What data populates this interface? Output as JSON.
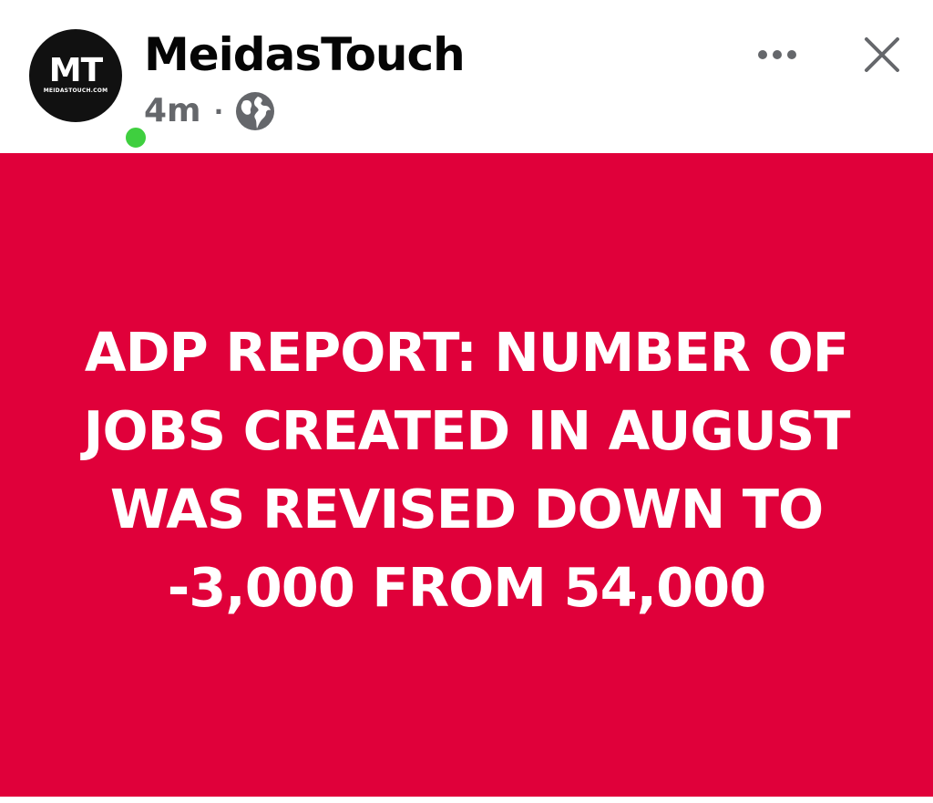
{
  "post": {
    "author": "MeidasTouch",
    "time": "4m",
    "separator": "·",
    "audience_icon": "globe-icon",
    "more_icon": "more-options-icon",
    "close_icon": "close-icon",
    "avatar": {
      "monogram": "MT",
      "subtext": "MEIDASTOUCH.COM",
      "online": true
    },
    "image_text": "ADP REPORT: NUMBER OF JOBS CREATED IN AUGUST WAS REVISED DOWN TO -3,000 FROM 54,000"
  },
  "colors": {
    "banner": "#e0003a",
    "online_dot": "#3fcf3f",
    "meta_text": "#65676b"
  }
}
